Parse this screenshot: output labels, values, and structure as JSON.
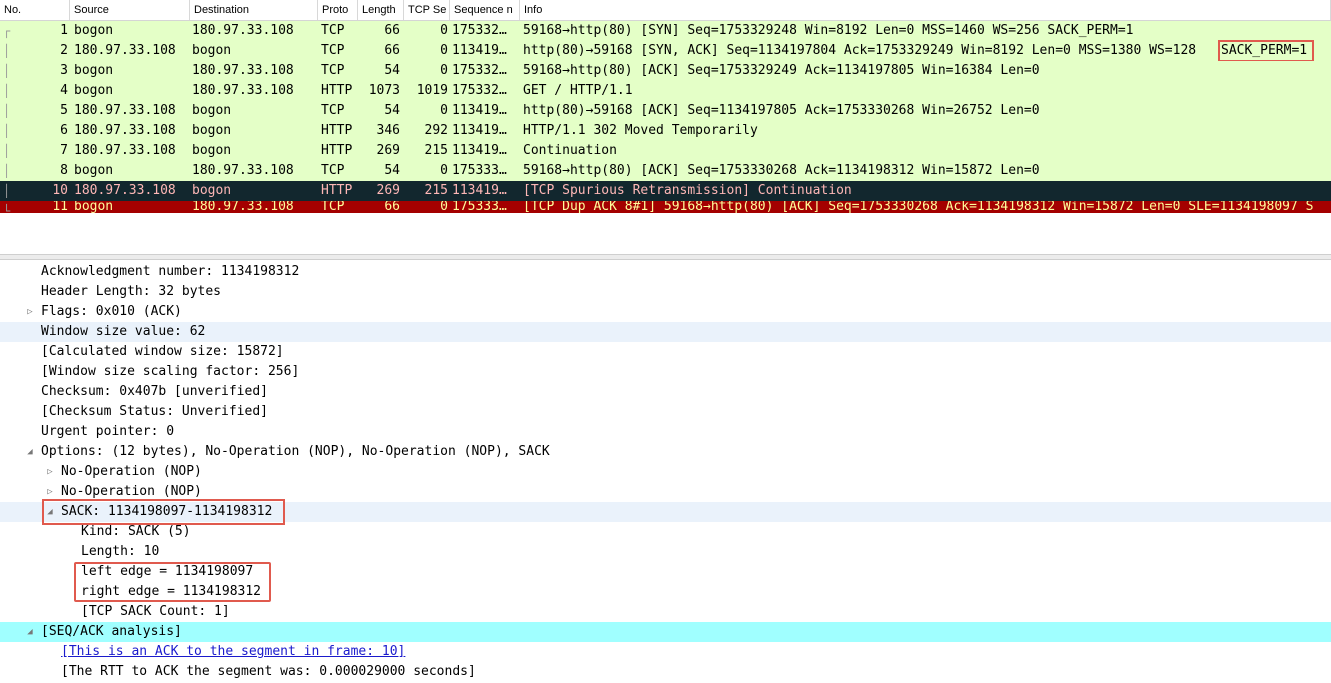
{
  "columns": [
    {
      "label": "No."
    },
    {
      "label": "Source"
    },
    {
      "label": "Destination"
    },
    {
      "label": "Proto"
    },
    {
      "label": "Length"
    },
    {
      "label": "TCP Se"
    },
    {
      "label": "Sequence n"
    },
    {
      "label": "Info"
    }
  ],
  "packets": [
    {
      "no": "1",
      "src": "bogon",
      "dst": "180.97.33.108",
      "proto": "TCP",
      "len": "66",
      "tcpseg": "0",
      "seq": "175332…",
      "info": "59168→http(80) [SYN] Seq=1753329248 Win=8192 Len=0 MSS=1460 WS=256 SACK_PERM=1"
    },
    {
      "no": "2",
      "src": "180.97.33.108",
      "dst": "bogon",
      "proto": "TCP",
      "len": "66",
      "tcpseg": "0",
      "seq": "113419…",
      "info": "http(80)→59168 [SYN, ACK] Seq=1134197804 Ack=1753329249 Win=8192 Len=0 MSS=1380 WS=128",
      "info_boxed": "SACK_PERM=1"
    },
    {
      "no": "3",
      "src": "bogon",
      "dst": "180.97.33.108",
      "proto": "TCP",
      "len": "54",
      "tcpseg": "0",
      "seq": "175332…",
      "info": "59168→http(80) [ACK] Seq=1753329249 Ack=1134197805 Win=16384 Len=0"
    },
    {
      "no": "4",
      "src": "bogon",
      "dst": "180.97.33.108",
      "proto": "HTTP",
      "len": "1073",
      "tcpseg": "1019",
      "seq": "175332…",
      "info": "GET / HTTP/1.1"
    },
    {
      "no": "5",
      "src": "180.97.33.108",
      "dst": "bogon",
      "proto": "TCP",
      "len": "54",
      "tcpseg": "0",
      "seq": "113419…",
      "info": "http(80)→59168 [ACK] Seq=1134197805 Ack=1753330268 Win=26752 Len=0"
    },
    {
      "no": "6",
      "src": "180.97.33.108",
      "dst": "bogon",
      "proto": "HTTP",
      "len": "346",
      "tcpseg": "292",
      "seq": "113419…",
      "info": "HTTP/1.1 302 Moved Temporarily"
    },
    {
      "no": "7",
      "src": "180.97.33.108",
      "dst": "bogon",
      "proto": "HTTP",
      "len": "269",
      "tcpseg": "215",
      "seq": "113419…",
      "info": "Continuation"
    },
    {
      "no": "8",
      "src": "bogon",
      "dst": "180.97.33.108",
      "proto": "TCP",
      "len": "54",
      "tcpseg": "0",
      "seq": "175333…",
      "info": "59168→http(80) [ACK] Seq=1753330268 Ack=1134198312 Win=15872 Len=0"
    },
    {
      "no": "10",
      "src": "180.97.33.108",
      "dst": "bogon",
      "proto": "HTTP",
      "len": "269",
      "tcpseg": "215",
      "seq": "113419…",
      "info": "[TCP Spurious Retransmission] Continuation"
    },
    {
      "no": "11",
      "src": "bogon",
      "dst": "180.97.33.108",
      "proto": "TCP",
      "len": "66",
      "tcpseg": "0",
      "seq": "175333…",
      "info": "[TCP Dup ACK 8#1] 59168→http(80) [ACK] Seq=1753330268 Ack=1134198312 Win=15872 Len=0 SLE=1134198097 S"
    }
  ],
  "details": [
    {
      "text": "Acknowledgment number: 1134198312",
      "indent": 0,
      "tri": ""
    },
    {
      "text": "Header Length: 32 bytes",
      "indent": 0,
      "tri": ""
    },
    {
      "text": "Flags: 0x010 (ACK)",
      "indent": 0,
      "tri": "collapsed"
    },
    {
      "text": "Window size value: 62",
      "indent": 0,
      "tri": "",
      "style": "hl"
    },
    {
      "text": "[Calculated window size: 15872]",
      "indent": 0,
      "tri": ""
    },
    {
      "text": "[Window size scaling factor: 256]",
      "indent": 0,
      "tri": ""
    },
    {
      "text": "Checksum: 0x407b [unverified]",
      "indent": 0,
      "tri": ""
    },
    {
      "text": "[Checksum Status: Unverified]",
      "indent": 0,
      "tri": ""
    },
    {
      "text": "Urgent pointer: 0",
      "indent": 0,
      "tri": ""
    },
    {
      "text": "Options: (12 bytes), No-Operation (NOP), No-Operation (NOP), SACK",
      "indent": 0,
      "tri": "expanded"
    },
    {
      "text": "No-Operation (NOP)",
      "indent": 1,
      "tri": "collapsed"
    },
    {
      "text": "No-Operation (NOP)",
      "indent": 1,
      "tri": "collapsed"
    },
    {
      "text": "SACK: 1134198097-1134198312",
      "indent": 1,
      "tri": "expanded",
      "style": "hl"
    },
    {
      "text": "Kind: SACK (5)",
      "indent": 2,
      "tri": ""
    },
    {
      "text": "Length: 10",
      "indent": 2,
      "tri": ""
    },
    {
      "text": "left edge = 1134198097",
      "indent": 2,
      "tri": ""
    },
    {
      "text": "right edge = 1134198312",
      "indent": 2,
      "tri": ""
    },
    {
      "text": "[TCP SACK Count: 1]",
      "indent": 2,
      "tri": ""
    },
    {
      "text": "[SEQ/ACK analysis]",
      "indent": 0,
      "tri": "expanded",
      "style": "seq"
    },
    {
      "text": "[This is an ACK to the segment in frame: 10]",
      "indent": 1,
      "tri": "",
      "style": "link"
    },
    {
      "text": "[The RTT to ACK the segment was: 0.000029000 seconds]",
      "indent": 1,
      "tri": ""
    }
  ],
  "colors": {
    "row_bg": "#e4ffc7",
    "selected_bg": "#12272e",
    "selected_fg": "#fdb7b6",
    "error_bg": "#a40000",
    "error_fg": "#fffc9c",
    "seq_ack_bg": "#a0ffff",
    "annotation_box": "#e05a4e"
  }
}
